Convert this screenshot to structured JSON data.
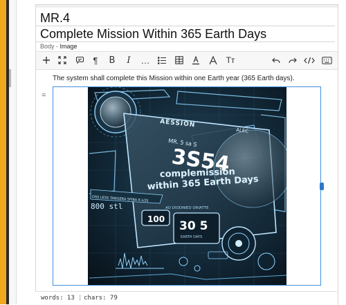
{
  "document": {
    "id_heading": "MR.4",
    "title": "Complete Mission Within 365 Earth Days",
    "breadcrumb": {
      "parent": "Body",
      "separator": " - ",
      "current": "Image"
    },
    "paragraph": "The system shall complete this Mission within one Earth year (365 Earth days).",
    "block_handle": "="
  },
  "toolbar": {
    "items": [
      {
        "name": "insert-icon"
      },
      {
        "name": "expand-icon"
      },
      {
        "name": "quote-icon"
      },
      {
        "name": "paragraph-icon"
      },
      {
        "name": "bold-icon"
      },
      {
        "name": "italic-icon"
      },
      {
        "name": "more-icon"
      },
      {
        "name": "list-icon"
      },
      {
        "name": "table-icon"
      },
      {
        "name": "text-color-icon"
      },
      {
        "name": "font-style-icon"
      },
      {
        "name": "text-size-icon"
      },
      {
        "name": "undo-icon"
      },
      {
        "name": "redo-icon"
      },
      {
        "name": "code-icon"
      },
      {
        "name": "keyboard-icon"
      }
    ],
    "glyphs": {
      "paragraph": "¶",
      "bold": "B",
      "italic": "I",
      "more": "…",
      "text_size": "Tт"
    }
  },
  "image": {
    "texts": {
      "panel_label": "AESSION",
      "panel_label_right": "ALEC",
      "mr_label": "MR. 5 sa S",
      "big_number": "3S54",
      "line1": "complemission",
      "line2": "within 365 Earth Days",
      "small_caption": "AO DIODNIED ORIATTE",
      "left_strip": "DSS LESS TANGERA SFIBA E-LOS",
      "left_value": "800 stl",
      "box1": "100",
      "box2": "30 5",
      "box2_sub": "EARTH DAYS"
    },
    "colors": {
      "bg": "#0b1a26",
      "cyan": "#8fd4ff",
      "glow": "#cfeeff",
      "panel": "#1d3444"
    }
  },
  "status_bar": {
    "words_label": "words: 13",
    "separator": "|",
    "chars_label": "chars: 79"
  }
}
